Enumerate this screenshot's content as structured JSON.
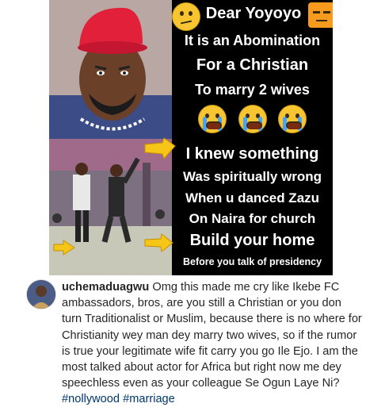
{
  "post": {
    "meme": {
      "lines": [
        "Dear Yoyoyo",
        "It is an Abomination",
        "For a Christian",
        "To marry 2 wives",
        "I knew something",
        "Was spiritually wrong",
        "When u danced Zazu",
        "On Naira for church",
        "Build your home",
        "Before you talk of presidency"
      ],
      "emojis": {
        "header_left": "confused-face-icon",
        "header_right": "unamused-face-icon",
        "crying_row": [
          "loudly-crying-face-icon",
          "loudly-crying-face-icon",
          "loudly-crying-face-icon"
        ],
        "pointers": [
          "pointing-hand-icon",
          "pointing-hand-icon",
          "pointing-hand-icon"
        ]
      },
      "colors": {
        "background": "#000000",
        "text": "#ffffff",
        "emoji_yellow": "#f7c531"
      }
    }
  },
  "comment": {
    "username": "uchemaduagwu",
    "text": "Omg this made me cry like Ikebe FC ambassadors, bros, are you still a Christian or you don turn Traditionalist or Muslim, because there is no where for Christianity wey man dey marry two wives, so if the rumor is true your legitimate wife fit carry you go Ile Ejo. I am the most talked about actor for Africa but right now me dey speechless even as your colleague Se Ogun Laye Ni?",
    "hashtags": [
      "#nollywood",
      "#marriage"
    ],
    "colors": {
      "text": "#262626",
      "hashtag": "#00376b"
    }
  }
}
